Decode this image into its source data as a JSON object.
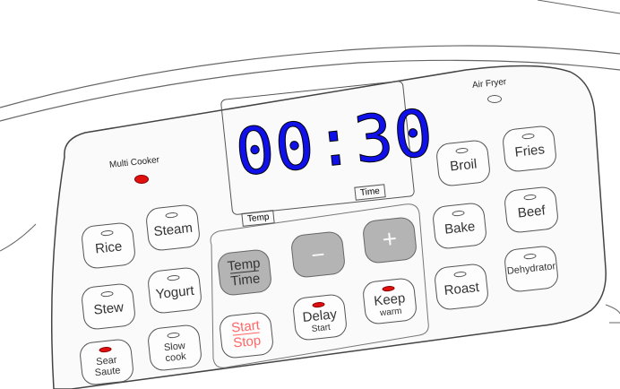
{
  "display": {
    "time": "00:30"
  },
  "labels": {
    "multi_cooker": "Multi Cooker",
    "air_fryer": "Air Fryer",
    "temp_tag": "Temp",
    "time_tag": "Time"
  },
  "left_buttons": {
    "rice": "Rice",
    "steam": "Steam",
    "stew": "Stew",
    "yogurt": "Yogurt",
    "sear_line1": "Sear",
    "sear_line2": "Saute",
    "slow_line1": "Slow",
    "slow_line2": "cook"
  },
  "center_buttons": {
    "temp_time_line1": "Temp",
    "temp_time_line2": "Time",
    "minus": "−",
    "plus": "+",
    "start_line1": "Start",
    "start_line2": "Stop",
    "delay": "Delay",
    "delay_sub": "Start",
    "keep": "Keep",
    "keep_sub": "warm"
  },
  "right_buttons": {
    "broil": "Broil",
    "fries": "Fries",
    "bake": "Bake",
    "beef": "Beef",
    "roast": "Roast",
    "dehydrator": "Dehydrator"
  },
  "colors": {
    "display_digits": "#1010e8",
    "indicator_active": "#e01010",
    "start_stop_text": "#ff6666",
    "grey_button": "#b4b4b4",
    "outline": "#555555"
  },
  "icons": [
    "indicator-light",
    "minus-icon",
    "plus-icon"
  ]
}
